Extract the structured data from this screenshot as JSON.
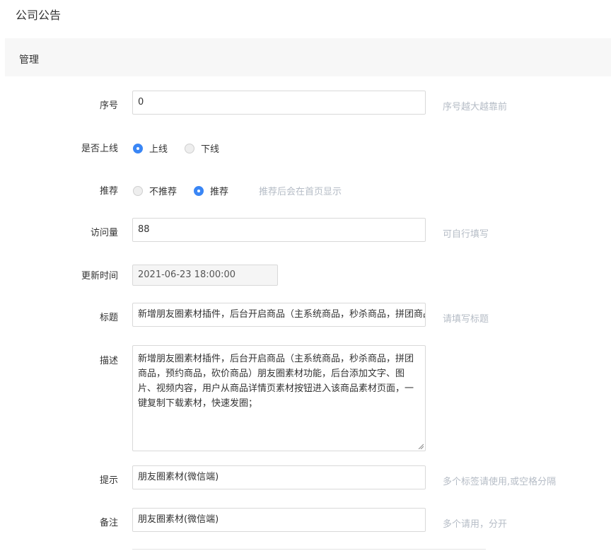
{
  "page": {
    "title": "公司公告"
  },
  "section": {
    "title": "管理"
  },
  "fields": {
    "order": {
      "label": "序号",
      "value": "0",
      "hint": "序号越大越靠前"
    },
    "online": {
      "label": "是否上线",
      "options": [
        "上线",
        "下线"
      ],
      "selected": "上线"
    },
    "recommend": {
      "label": "推荐",
      "options": [
        "不推荐",
        "推荐"
      ],
      "selected": "推荐",
      "hint": "推荐后会在首页显示"
    },
    "views": {
      "label": "访问量",
      "value": "88",
      "hint": "可自行填写"
    },
    "updated": {
      "label": "更新时间",
      "value": "2021-06-23 18:00:00"
    },
    "title": {
      "label": "标题",
      "value": "新增朋友圈素材插件，后台开启商品（主系统商品，秒杀商品，拼团商品，预约商品，砍价商品）",
      "hint": "请填写标题"
    },
    "description": {
      "label": "描述",
      "value": "新增朋友圈素材插件，后台开启商品（主系统商品，秒杀商品，拼团商品，预约商品，砍价商品）朋友圈素材功能，后台添加文字、图片、视频内容，用户从商品详情页素材按钮进入该商品素材页面，一键复制下载素材，快速发圈；"
    },
    "tips": {
      "label": "提示",
      "value": "朋友圈素材(微信端)",
      "hint": "多个标签请使用,或空格分隔"
    },
    "remark": {
      "label": "备注",
      "value": "朋友圈素材(微信端)",
      "hint": "多个请用，分开"
    }
  },
  "colors": {
    "accent": "#3a86f5",
    "hint": "#b5bcc6",
    "border": "#d9d9d9"
  }
}
